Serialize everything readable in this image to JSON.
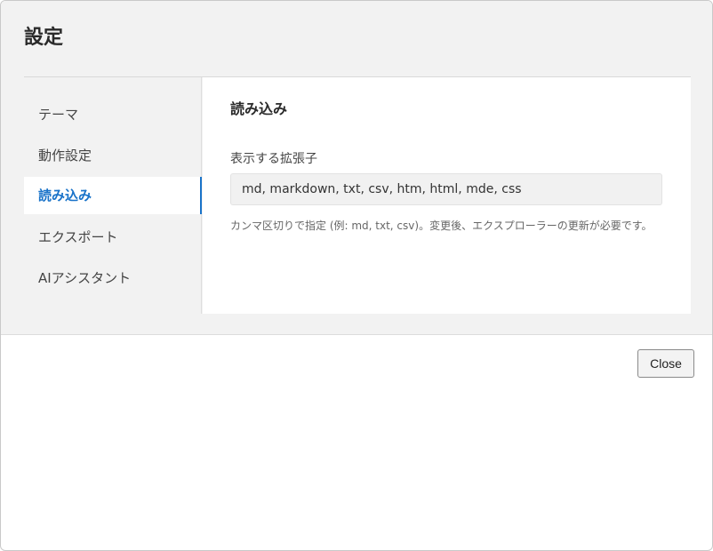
{
  "dialog": {
    "title": "設定",
    "close_label": "Close"
  },
  "sidebar": {
    "items": [
      {
        "label": "テーマ",
        "active": false
      },
      {
        "label": "動作設定",
        "active": false
      },
      {
        "label": "読み込み",
        "active": true
      },
      {
        "label": "エクスポート",
        "active": false
      },
      {
        "label": "AIアシスタント",
        "active": false
      }
    ]
  },
  "panel": {
    "section_title": "読み込み",
    "field_label": "表示する拡張子",
    "field_value": "md, markdown, txt, csv, htm, html, mde, css",
    "help_text": "カンマ区切りで指定 (例: md, txt, csv)。変更後、エクスプローラーの更新が必要です。"
  },
  "colors": {
    "accent": "#1a73c9",
    "background": "#f2f2f2",
    "panel": "#ffffff"
  }
}
